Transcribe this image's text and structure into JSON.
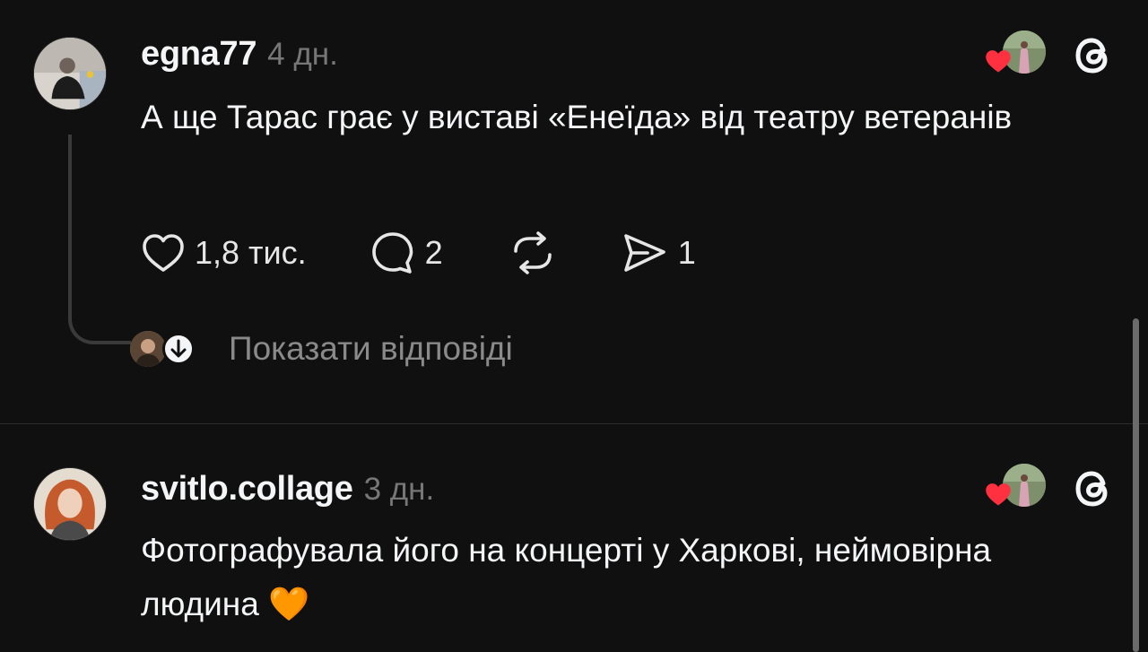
{
  "posts": [
    {
      "username": "egna77",
      "time": "4 дн.",
      "text": "А ще Тарас грає у виставі «Енеїда» від театру ветеранів",
      "likes": "1,8 тис.",
      "comments": "2",
      "shares": "1",
      "show_replies_label": "Показати відповіді"
    },
    {
      "username": "svitlo.collage",
      "time": "3 дн.",
      "text": "Фотографувала його на концерті у Харкові, неймовірна людина 🧡"
    }
  ],
  "colors": {
    "background": "#101010",
    "text": "#f3f5f7",
    "muted": "#777777",
    "heart": "#ff3040",
    "divider": "#2d2d2d"
  },
  "icons": [
    "heart-icon",
    "comment-icon",
    "repost-icon",
    "share-icon",
    "threads-logo-icon",
    "chevron-down-icon"
  ]
}
